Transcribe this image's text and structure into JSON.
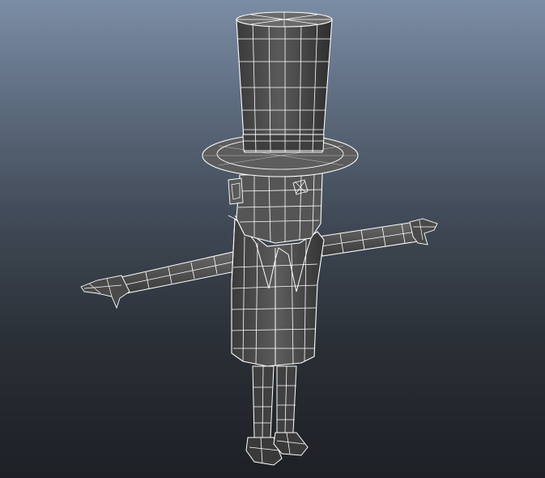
{
  "viewport": {
    "background_top": "#7b8da5",
    "background_bottom": "#1d2025",
    "mesh_fill": "#4f4f4f",
    "mesh_fill_dark": "#363636",
    "mesh_fill_light": "#6a6a6a",
    "wire_color": "#ffffff"
  },
  "model": {
    "parts": [
      "top-hat",
      "head",
      "coat",
      "left-arm",
      "right-arm",
      "left-leg",
      "right-leg",
      "left-shoe",
      "right-shoe"
    ]
  }
}
